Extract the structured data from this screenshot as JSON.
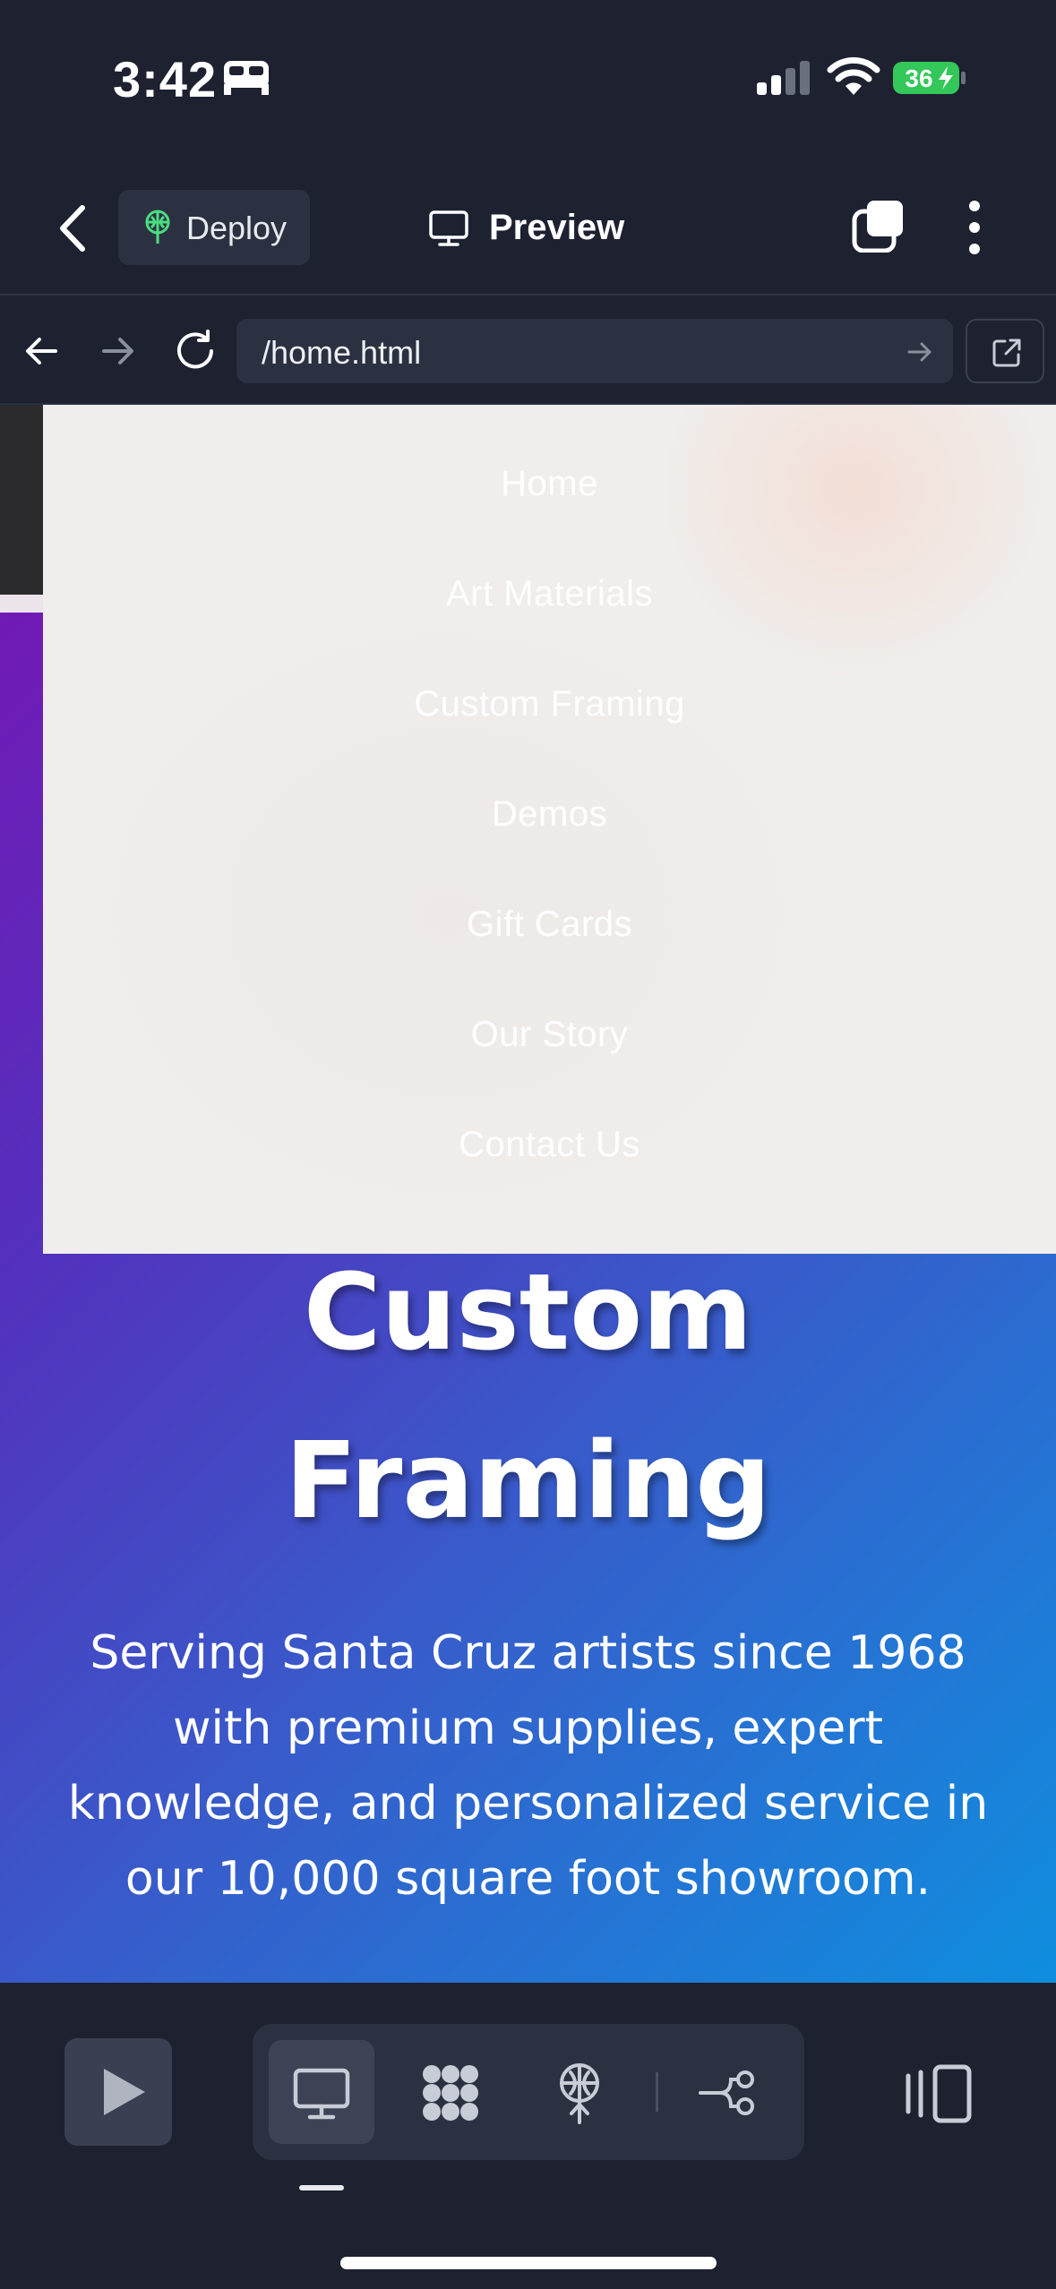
{
  "status": {
    "time": "3:42",
    "battery": "36"
  },
  "header": {
    "deploy_label": "Deploy",
    "preview_label": "Preview"
  },
  "browser": {
    "url": "/home.html"
  },
  "menu": {
    "items": [
      "Home",
      "Art Materials",
      "Custom Framing",
      "Demos",
      "Gift Cards",
      "Our Story",
      "Contact Us"
    ]
  },
  "hero": {
    "title_line1": "Custom",
    "title_line2": "Framing",
    "subtitle": "Serving Santa Cruz artists since 1968 with premium supplies, expert knowledge, and personalized service in our 10,000 square foot showroom."
  },
  "colors": {
    "app_bg": "#1d2130",
    "panel": "#2c3142",
    "battery_green": "#34c759",
    "deploy_icon": "#4ade80"
  },
  "icons": [
    "bed-icon",
    "signal-icon",
    "wifi-icon",
    "battery-icon",
    "back-icon",
    "deploy-icon",
    "monitor-icon",
    "tabs-icon",
    "more-icon",
    "arrow-left-icon",
    "arrow-right-icon",
    "reload-icon",
    "external-link-icon",
    "play-icon",
    "grid-icon",
    "globe-icon",
    "branch-icon",
    "sidebar-icon"
  ]
}
